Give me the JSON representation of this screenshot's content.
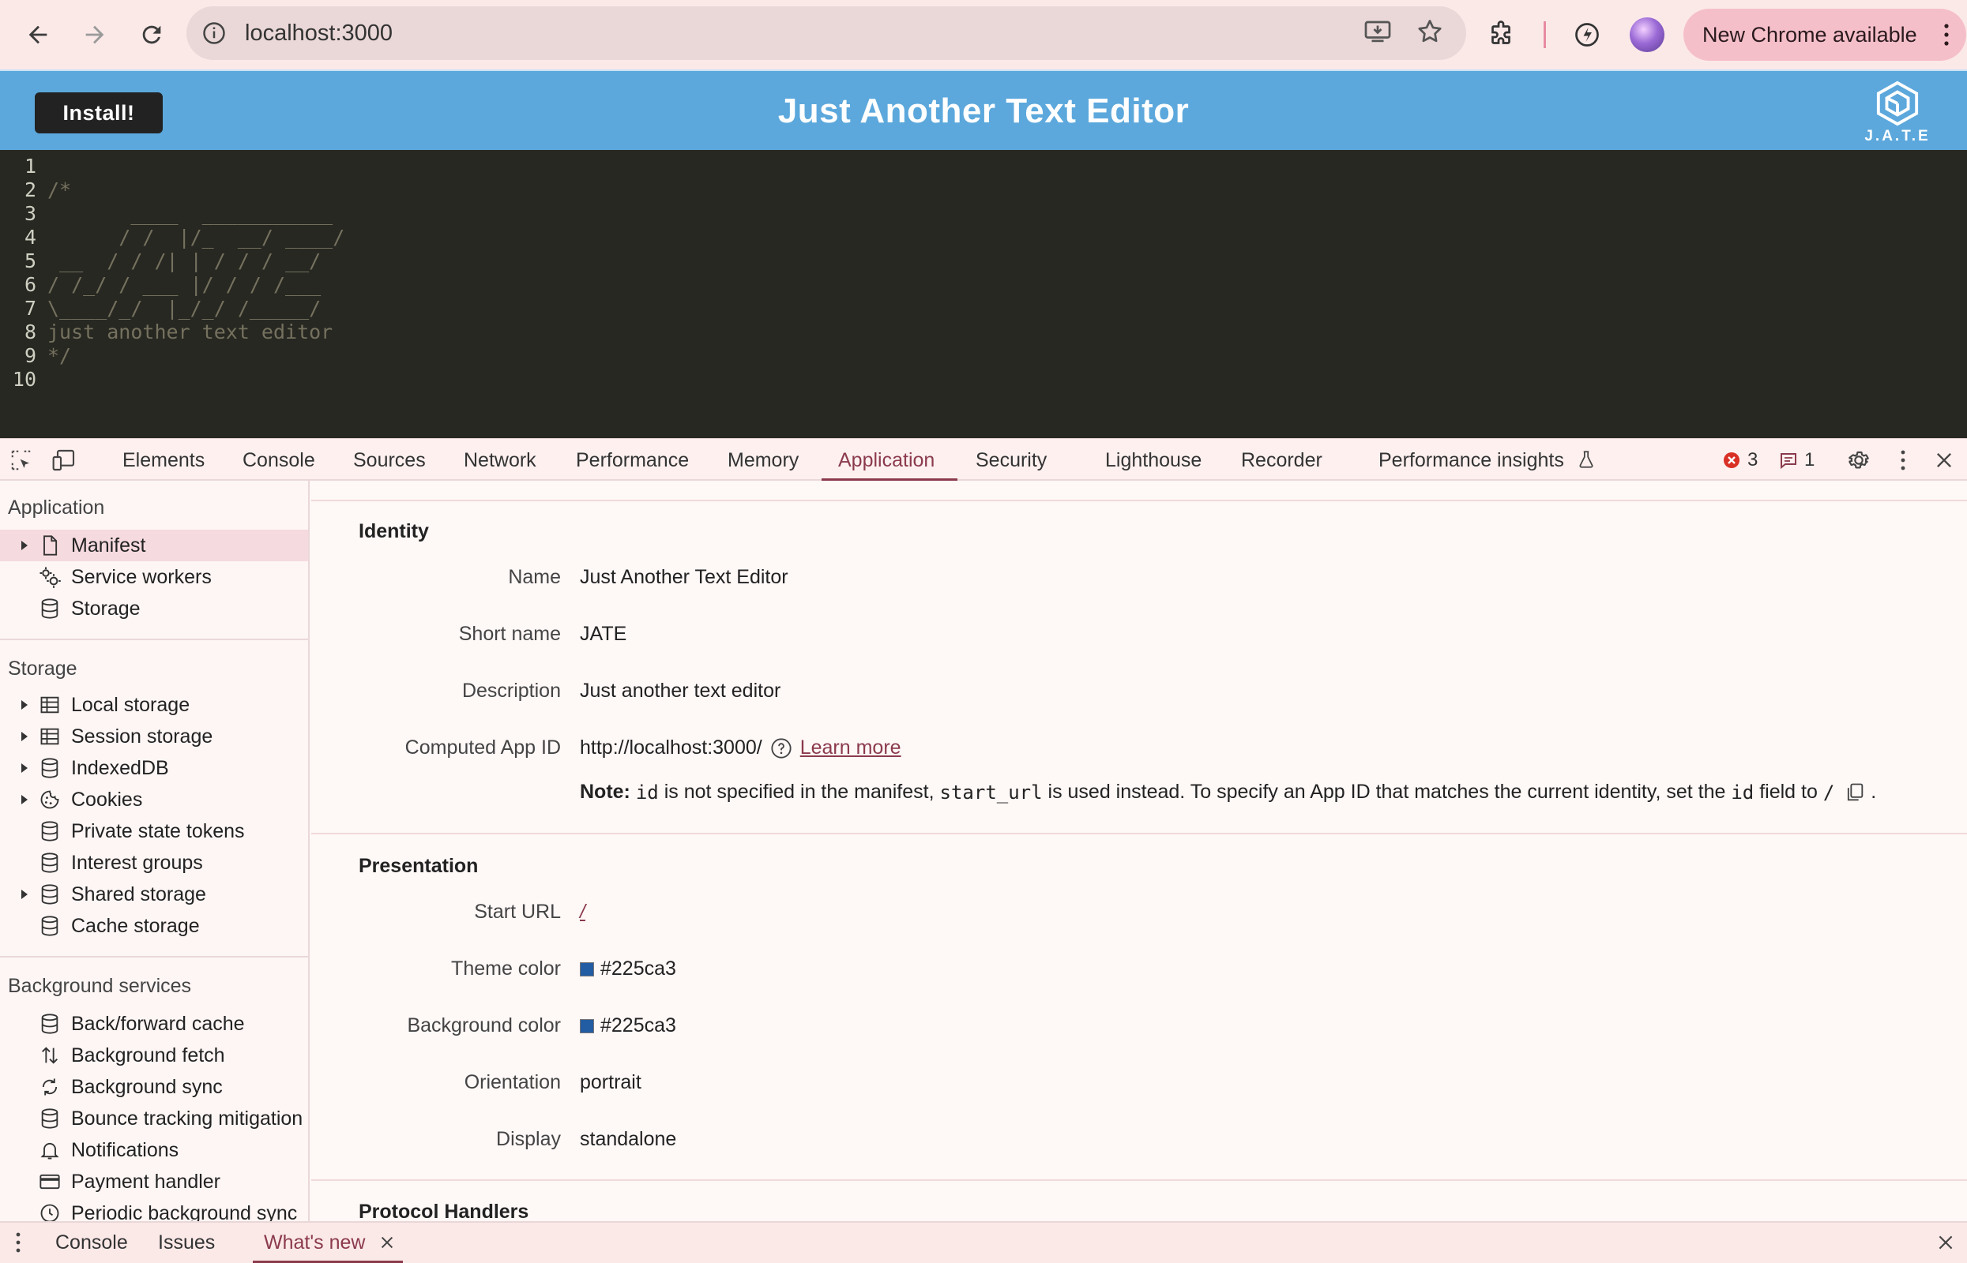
{
  "browser": {
    "url": "localhost:3000",
    "new_chrome_label": "New Chrome available"
  },
  "app": {
    "install_label": "Install!",
    "title": "Just Another Text Editor",
    "logo_text": "J.A.T.E"
  },
  "editor": {
    "lines": [
      {
        "n": "1",
        "text": ""
      },
      {
        "n": "2",
        "text": "/*"
      },
      {
        "n": "3",
        "text": "       ____  ___________"
      },
      {
        "n": "4",
        "text": "      / /  |/_  __/ ____/"
      },
      {
        "n": "5",
        "text": " __  / / /| | / / / __/"
      },
      {
        "n": "6",
        "text": "/ /_/ / ___ |/ / / /___"
      },
      {
        "n": "7",
        "text": "\\____/_/  |_/_/ /_____/"
      },
      {
        "n": "8",
        "text": "just another text editor"
      },
      {
        "n": "9",
        "text": "*/"
      },
      {
        "n": "10",
        "text": ""
      }
    ]
  },
  "devtools": {
    "tabs": [
      "Elements",
      "Console",
      "Sources",
      "Network",
      "Performance",
      "Memory",
      "Application",
      "Security",
      "Lighthouse",
      "Recorder",
      "Performance insights"
    ],
    "active_tab": "Application",
    "error_count": "3",
    "message_count": "1",
    "sidebar": {
      "application_title": "Application",
      "application_items": [
        "Manifest",
        "Service workers",
        "Storage"
      ],
      "storage_title": "Storage",
      "storage_items": [
        "Local storage",
        "Session storage",
        "IndexedDB",
        "Cookies",
        "Private state tokens",
        "Interest groups",
        "Shared storage",
        "Cache storage"
      ],
      "background_title": "Background services",
      "background_items": [
        "Back/forward cache",
        "Background fetch",
        "Background sync",
        "Bounce tracking mitigation",
        "Notifications",
        "Payment handler",
        "Periodic background sync"
      ]
    },
    "manifest": {
      "identity_title": "Identity",
      "name_label": "Name",
      "name_value": "Just Another Text Editor",
      "short_name_label": "Short name",
      "short_name_value": "JATE",
      "description_label": "Description",
      "description_value": "Just another text editor",
      "app_id_label": "Computed App ID",
      "app_id_value": "http://localhost:3000/",
      "learn_more": "Learn more",
      "note_bold": "Note:",
      "note_id": "id",
      "note_text_1": "is not specified in the manifest,",
      "note_start_url": "start_url",
      "note_text_2": "is used instead. To specify an App ID that matches the current identity, set the",
      "note_id_2": "id",
      "note_text_3": "field to",
      "note_slash": "/",
      "note_end": ".",
      "presentation_title": "Presentation",
      "start_url_label": "Start URL",
      "start_url_value": "/",
      "theme_color_label": "Theme color",
      "theme_color_value": "#225ca3",
      "bg_color_label": "Background color",
      "bg_color_value": "#225ca3",
      "orientation_label": "Orientation",
      "orientation_value": "portrait",
      "display_label": "Display",
      "display_value": "standalone",
      "protocol_title": "Protocol Handlers"
    },
    "drawer": {
      "tabs": [
        "Console",
        "Issues",
        "What's new"
      ],
      "active": "What's new"
    }
  },
  "colors": {
    "header_blue": "#5ca8dc",
    "editor_bg": "#272822",
    "accent": "#8b3a4c",
    "theme_swatch": "#225ca3"
  }
}
